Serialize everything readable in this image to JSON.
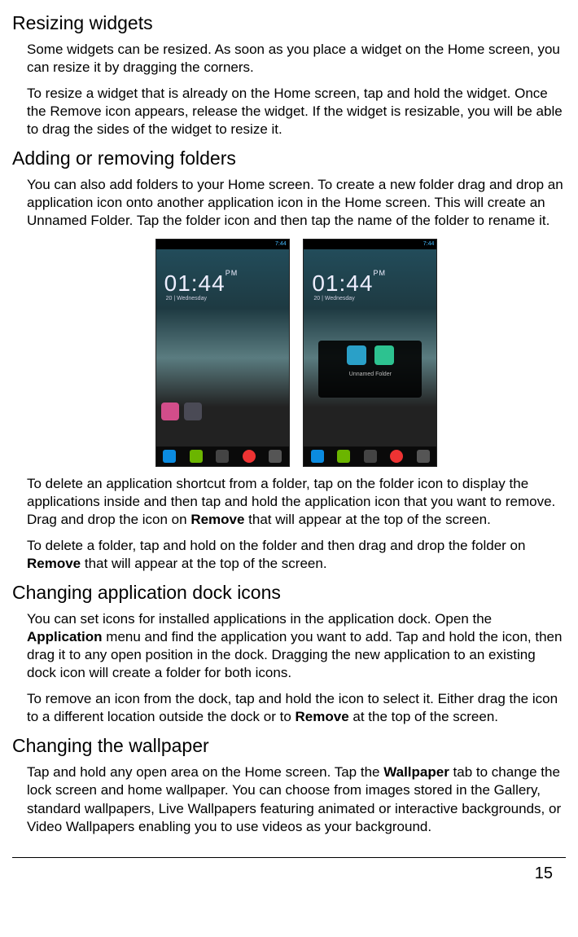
{
  "sections": {
    "resizing": {
      "heading": "Resizing widgets",
      "p1": "Some widgets can be resized. As soon as you place a widget on the Home screen, you can resize it by dragging the corners.",
      "p2": "To resize a widget that is already on the Home screen, tap and hold the widget. Once the Remove icon appears, release the widget. If the widget is resizable, you will be able to drag the sides of the widget to resize it."
    },
    "folders": {
      "heading": "Adding or removing folders",
      "p1": "You can also add folders to your Home screen. To create a new folder drag and drop an application icon onto another application icon in the Home screen. This will create an Unnamed Folder. Tap the folder icon and then tap the name of the folder to rename it.",
      "p2a": "To delete an application shortcut from a folder, tap on the folder icon to display the applications inside and then tap and hold the application icon that you want to remove. Drag and drop the icon on ",
      "p2b": "Remove",
      "p2c": " that will appear at the top of the screen.",
      "p3a": "To delete a folder, tap and hold on the folder and then drag and drop the folder on ",
      "p3b": "Remove",
      "p3c": " that will appear at the top of the screen."
    },
    "dock": {
      "heading": "Changing application dock icons",
      "p1a": "You can set icons for installed applications in the application dock. Open the ",
      "p1b": "Application",
      "p1c": " menu and find the application you want to add. Tap and hold the icon, then drag it to any open position in the dock. Dragging the new application to an existing dock icon will create a folder for both icons.",
      "p2a": "To remove an icon from the dock, tap and hold the icon to select it. Either drag the icon to a different location outside the dock or to ",
      "p2b": "Remove",
      "p2c": " at the top of the screen."
    },
    "wallpaper": {
      "heading": "Changing the wallpaper",
      "p1a": "Tap and hold any open area on the Home screen. Tap the ",
      "p1b": "Wallpaper",
      "p1c": " tab to change the lock screen and home wallpaper. You can choose from images stored in the Gallery, standard wallpapers, Live Wallpapers featuring animated or interactive backgrounds, or Video Wallpapers enabling you to use videos as your background."
    }
  },
  "figures": {
    "status_time": "7:44",
    "clock_time": "01:44",
    "clock_ampm": "PM",
    "clock_date": "20 | Wednesday",
    "folder_label": "Unnamed Folder"
  },
  "page_number": "15"
}
